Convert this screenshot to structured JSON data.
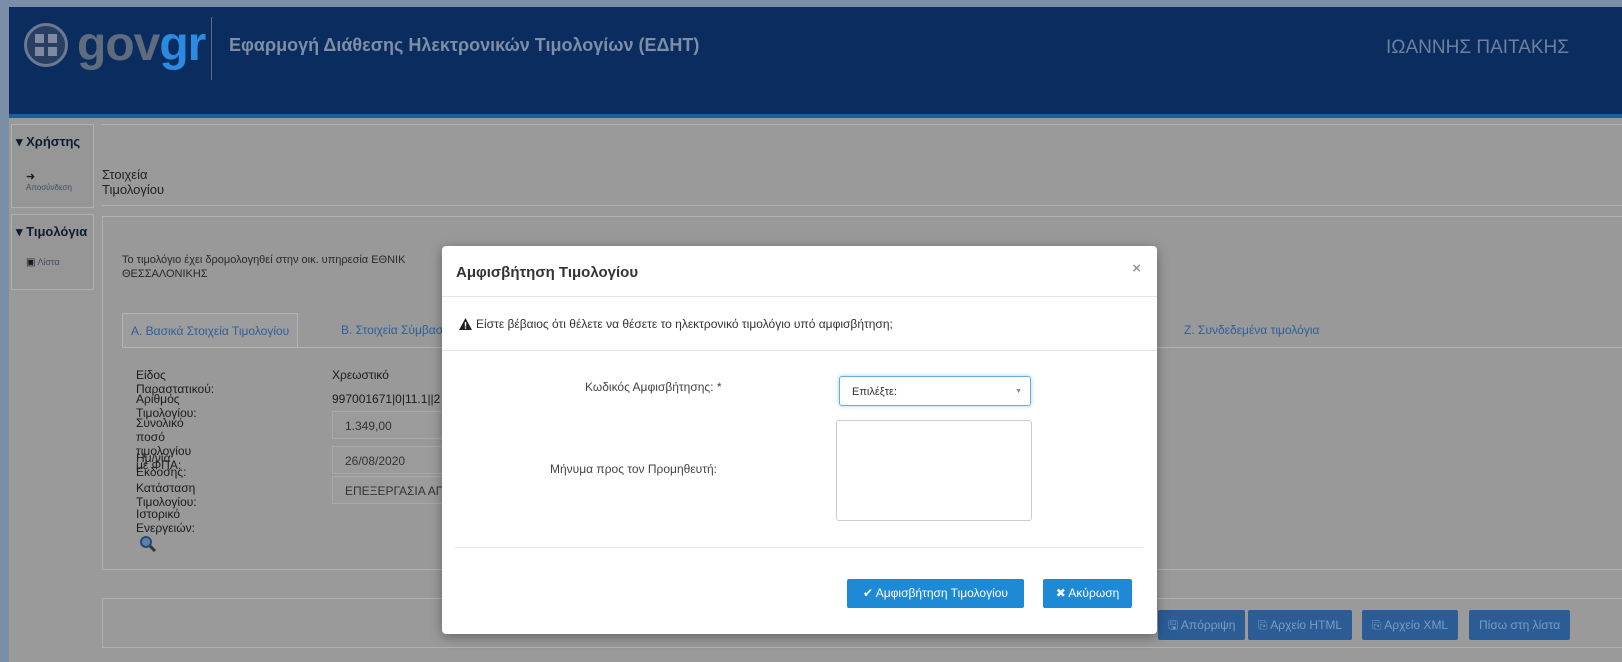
{
  "header": {
    "logo_gov": "gov",
    "logo_gr": "gr",
    "app_title": "Εφαρμογή Διάθεσης Ηλεκτρονικών Τιμολογίων (ΕΔΗΤ)",
    "user_name": "ΙΩΑΝΝΗΣ ΠΑΙΤΑΚΗΣ"
  },
  "sidebar": {
    "sections": [
      {
        "title": "Χρήστης",
        "item_label": "Αποσύνδεση",
        "item_icon": "sign-out-icon"
      },
      {
        "title": "Τιμολόγια",
        "item_label": "Λίστα",
        "item_icon": "list-icon"
      }
    ]
  },
  "page": {
    "title": "Στοιχεία Τιμολογίου",
    "notice_line1": "Το τιμολόγιο έχει δρομολογηθεί στην οικ. υπηρεσία ΕΘΝΙΚ",
    "notice_line2": "ΘΕΣΣΑΛΟΝΙΚΗΣ",
    "tabs": [
      {
        "label": "Α. Βασικά Στοιχεία Τιμολογίου",
        "active": true
      },
      {
        "label": "Β. Στοιχεία Σύμβασ",
        "active": false
      },
      {
        "label": "Ζ. Συνδεδεμένα τιμολόγια",
        "active": false
      }
    ],
    "fields": [
      {
        "label": "Είδος Παραστατικού:",
        "value": "Χρεωστικό"
      },
      {
        "label": "Αριθμός Τιμολογίου:",
        "value": "997001671|0|11.1||2"
      },
      {
        "label": "Συνολικό ποσό τιμολογίου με ΦΠΑ:",
        "value": "1.349,00"
      },
      {
        "label": "Ημ/νία Εκδοσης:",
        "value": "26/08/2020"
      },
      {
        "label": "Κατάσταση Τιμολογίου:",
        "value": "ΕΠΕΞΕΡΓΑΣΙΑ ΑΠΟ"
      },
      {
        "label": "Ιστορικό Ενεργειών:",
        "value": ""
      }
    ],
    "bottom_buttons": [
      "Απόρριψη",
      "Αρχείο HTML",
      "Αρχείο XML",
      "Πίσω στη λίστα"
    ]
  },
  "modal": {
    "title": "Αμφισβήτηση Τιμολογίου",
    "close_symbol": "×",
    "warning": "Είστε βέβαιος ότι θέλετε να θέσετε το ηλεκτρονικό τιμολόγιο υπό αμφισβήτηση;",
    "code_label": "Κωδικός Αμφισβήτησης: *",
    "code_select_value": "Επιλέξτε:",
    "message_label": "Μήνυμα προς τον Προμηθευτή:",
    "message_value": "",
    "confirm_button": "✔ Αμφισβήτηση Τιμολογίου",
    "cancel_button": "✖ Ακύρωση"
  },
  "colors": {
    "header_bg": "#0b2c5e",
    "overlay_bg": "#9a9a9a",
    "primary_button": "#1e8ad6",
    "link": "#2e5f97"
  }
}
